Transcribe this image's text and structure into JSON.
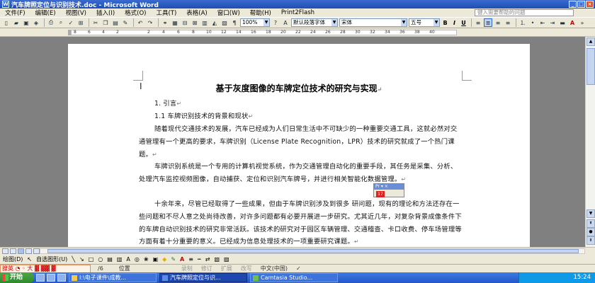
{
  "window": {
    "title": "汽车牌照定位与识别技术.doc - Microsoft Word"
  },
  "menu": {
    "items": [
      "文件(F)",
      "编辑(E)",
      "视图(V)",
      "插入(I)",
      "格式(O)",
      "工具(T)",
      "表格(A)",
      "窗口(W)",
      "帮助(H)",
      "Print2Flash"
    ],
    "help_placeholder": "键入需要帮助的问题"
  },
  "toolbar": {
    "zoom": "100%",
    "style": "默认段落字体",
    "font": "宋体",
    "size": "五号",
    "bold": "B",
    "italic": "I",
    "underline": "U"
  },
  "ruler": {
    "ticks": [
      "8",
      "6",
      "4",
      "2",
      "2",
      "4",
      "6",
      "8",
      "10",
      "12",
      "14",
      "16",
      "18",
      "20",
      "22",
      "24",
      "26",
      "28",
      "30",
      "32",
      "34",
      "36",
      "38",
      "40"
    ]
  },
  "document": {
    "title": "基于灰度图像的车牌定位技术的研究与实现",
    "p1": "1. 引言",
    "p2": "1.1  车牌识别技术的背景和现状",
    "p3": "随着现代交通技术的发展，汽车已经成为人们日常生活中不可缺少的一种重要交通工具，这就必然对交通管理有一个更高的要求，车牌识别（License Plate Recognition，LPR）技术的研究就成了一个热门课题。",
    "p4": "车牌识别系统是一个专用的计算机视觉系统，作为交通管理自动化的重要手段，其任务是采集、分析、处理汽车监控视频图像，自动捕获、定位和识别汽车牌号，并进行相关智能化数据管理。",
    "p5": "十余年来，尽管已经取得了一些成果，但由于车牌识别涉及到很多              研问题，现有的理论和方法还存在一些问题和不尽人意之处尚待改善，对许多问题都有必要开展进一步研究。尤其近几年，对复杂背景成像条件下的车牌自动识别技术的研究非常活跃。该技术的研究对于园区车辆管理、交通稽查、卡口收费、停车场管理等方面有着十分重要的意义。已经成为信息处理技术的一项重要研究课题。"
  },
  "ime_float": {
    "label": "Pr",
    "badge": "17"
  },
  "drawbar": {
    "draw": "绘图(D)",
    "autoshape": "自选图形(U)"
  },
  "statusbar": {
    "ime_text": "搜英 ◔ ◦ 大 ▓ ▓▓ ▓",
    "page": "/6",
    "position": "位置",
    "rec": "录制",
    "trk": "修订",
    "ext": "扩展",
    "ovr": "改写",
    "lang": "中文(中国)"
  },
  "taskbar": {
    "start": "开始",
    "tasks": [
      "I:\\电子课件\\成教...",
      "汽车牌照定位与识...",
      "Camtasia Studio..."
    ],
    "clock": "15:24"
  },
  "colors": {
    "titlebar": "#1f4fb5",
    "taskbar": "#2456c9",
    "start": "#2f8a2c",
    "chrome": "#ece9d8"
  }
}
